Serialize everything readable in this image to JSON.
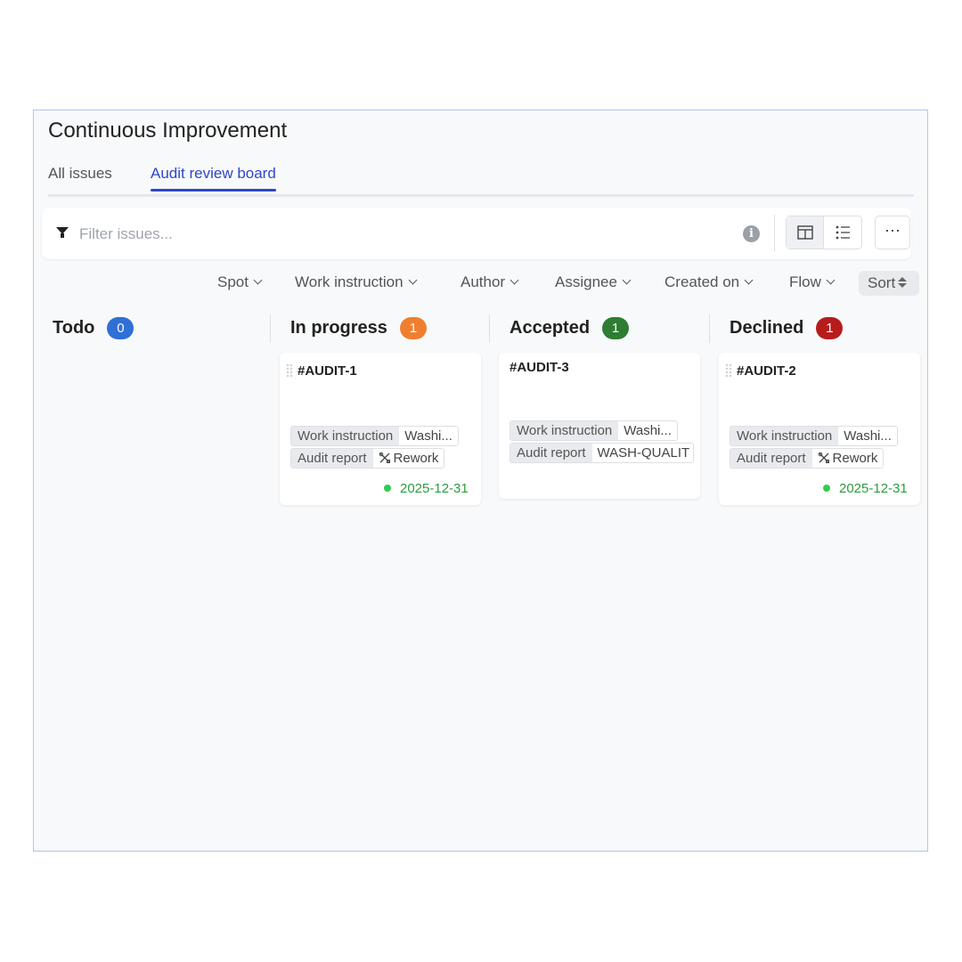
{
  "header": {
    "title": "Continuous Improvement"
  },
  "tabs": {
    "all": "All issues",
    "board": "Audit review board"
  },
  "filter": {
    "placeholder": "Filter issues...",
    "more": "···"
  },
  "filters": {
    "spot": "Spot",
    "work_instruction": "Work instruction",
    "author": "Author",
    "assignee": "Assignee",
    "created_on": "Created on",
    "flow": "Flow",
    "sort": "Sort"
  },
  "columns": [
    {
      "name": "Todo",
      "count": "0",
      "color": "#2f6fd6"
    },
    {
      "name": "In progress",
      "count": "1",
      "color": "#ef7f2f"
    },
    {
      "name": "Accepted",
      "count": "1",
      "color": "#2e7d32"
    },
    {
      "name": "Declined",
      "count": "1",
      "color": "#b71c1c"
    }
  ],
  "cards": {
    "audit1": {
      "id": "#AUDIT-1",
      "wi_key": "Work instruction",
      "wi_val": "Washi...",
      "ar_key": "Audit report",
      "ar_val": "Rework",
      "due": "2025-12-31"
    },
    "audit3": {
      "id": "#AUDIT-3",
      "wi_key": "Work instruction",
      "wi_val": "Washi...",
      "ar_key": "Audit report",
      "ar_val": "WASH-QUALIT"
    },
    "audit2": {
      "id": "#AUDIT-2",
      "wi_key": "Work instruction",
      "wi_val": "Washi...",
      "ar_key": "Audit report",
      "ar_val": "Rework",
      "due": "2025-12-31"
    }
  }
}
